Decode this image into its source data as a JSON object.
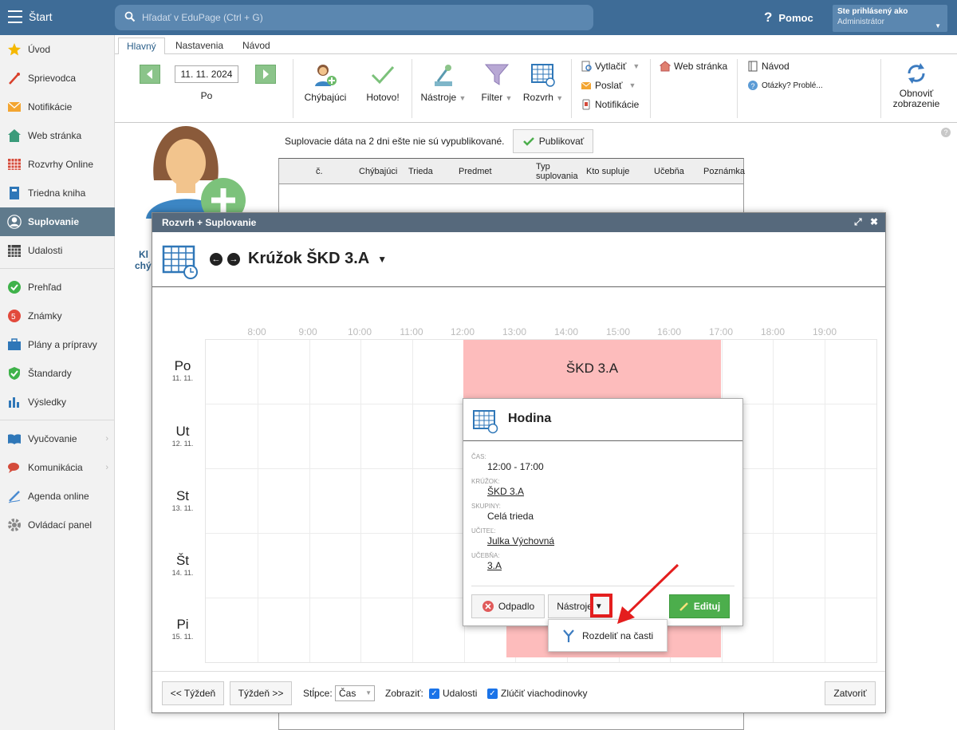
{
  "topbar": {
    "title": "Štart",
    "search_placeholder": "Hľadať v EduPage (Ctrl + G)",
    "help_label": "Pomoc",
    "user_line1": "Ste prihlásený ako",
    "user_line2": "Administrátor"
  },
  "sidebar": {
    "items": [
      {
        "label": "Úvod",
        "icon": "star-icon"
      },
      {
        "label": "Sprievodca",
        "icon": "wand-icon"
      },
      {
        "label": "Notifikácie",
        "icon": "envelope-icon"
      },
      {
        "label": "Web stránka",
        "icon": "house-icon"
      },
      {
        "label": "Rozvrhy Online",
        "icon": "calendar-grid-icon"
      },
      {
        "label": "Triedna kniha",
        "icon": "book-icon"
      },
      {
        "label": "Suplovanie",
        "icon": "person-icon"
      },
      {
        "label": "Udalosti",
        "icon": "calendar-icon"
      },
      {
        "label": "Prehľad",
        "icon": "check-circle-icon"
      },
      {
        "label": "Známky",
        "icon": "grade-icon"
      },
      {
        "label": "Plány a prípravy",
        "icon": "briefcase-icon"
      },
      {
        "label": "Štandardy",
        "icon": "shield-check-icon"
      },
      {
        "label": "Výsledky",
        "icon": "bar-chart-icon"
      },
      {
        "label": "Vyučovanie",
        "icon": "open-book-icon"
      },
      {
        "label": "Komunikácia",
        "icon": "chat-icon"
      },
      {
        "label": "Agenda online",
        "icon": "pen-icon"
      },
      {
        "label": "Ovládací panel",
        "icon": "gear-icon"
      }
    ]
  },
  "ribbon": {
    "tabs": [
      "Hlavný",
      "Nastavenia",
      "Návod"
    ],
    "date": "11. 11. 2024",
    "day": "Po",
    "missing_label": "Chýbajúci",
    "done_label": "Hotovo!",
    "tools_label": "Nástroje",
    "filter_label": "Filter",
    "timetable_label": "Rozvrh",
    "print_label": "Vytlačiť",
    "send_label": "Poslať",
    "notify_label": "Notifikácie",
    "web_label": "Web stránka",
    "guide_label": "Návod",
    "questions_label": "Otázky? Problé...",
    "refresh_line1": "Obnoviť",
    "refresh_line2": "zobrazenie"
  },
  "content": {
    "notice": "Suplovacie dáta na 2 dni ešte nie sú vypublikované.",
    "publish_label": "Publikovať",
    "columns": [
      "č.",
      "Chýbajúci",
      "Trieda",
      "Predmet",
      "Typ suplovania",
      "Kto supluje",
      "Učebňa",
      "Poznámka"
    ],
    "side_label_1": "Kl",
    "side_label_2": "chý"
  },
  "modal": {
    "header": "Rozvrh + Suplovanie",
    "title": "Krúžok ŠKD 3.A",
    "hours": [
      "8:00",
      "9:00",
      "10:00",
      "11:00",
      "12:00",
      "13:00",
      "14:00",
      "15:00",
      "16:00",
      "17:00",
      "18:00",
      "19:00"
    ],
    "days": [
      {
        "name": "Po",
        "date": "11. 11."
      },
      {
        "name": "Ut",
        "date": "12. 11."
      },
      {
        "name": "St",
        "date": "13. 11."
      },
      {
        "name": "Št",
        "date": "14. 11."
      },
      {
        "name": "Pi",
        "date": "15. 11."
      }
    ],
    "event_label": "ŠKD 3.A",
    "prev_week": "<< Týždeň",
    "next_week": "Týždeň >>",
    "columns_label": "Stĺpce:",
    "columns_value": "Čas",
    "show_label": "Zobraziť:",
    "events_label": "Udalosti",
    "merge_label": "Zlúčiť viachodinovky",
    "close_label": "Zatvoriť"
  },
  "popup": {
    "title": "Hodina",
    "time_label": "Čas:",
    "time_value": "12:00 - 17:00",
    "club_label": "Krúžok:",
    "club_value": "ŠKD 3.A",
    "groups_label": "Skupiny:",
    "groups_value": "Celá trieda",
    "teacher_label": "Učiteľ:",
    "teacher_value": "Julka Výchovná",
    "room_label": "Učebňa:",
    "room_value": "3.A",
    "cancel_label": "Odpadlo",
    "tools_label": "Nástroje",
    "edit_label": "Edituj",
    "menu_item": "Rozdeliť na časti"
  },
  "colors": {
    "topbar": "#3e6c97",
    "active_sidebar": "#5f7a8c",
    "event": "#fdbcbc",
    "edit_button": "#4cae4c",
    "highlight": "#e41e1e"
  }
}
